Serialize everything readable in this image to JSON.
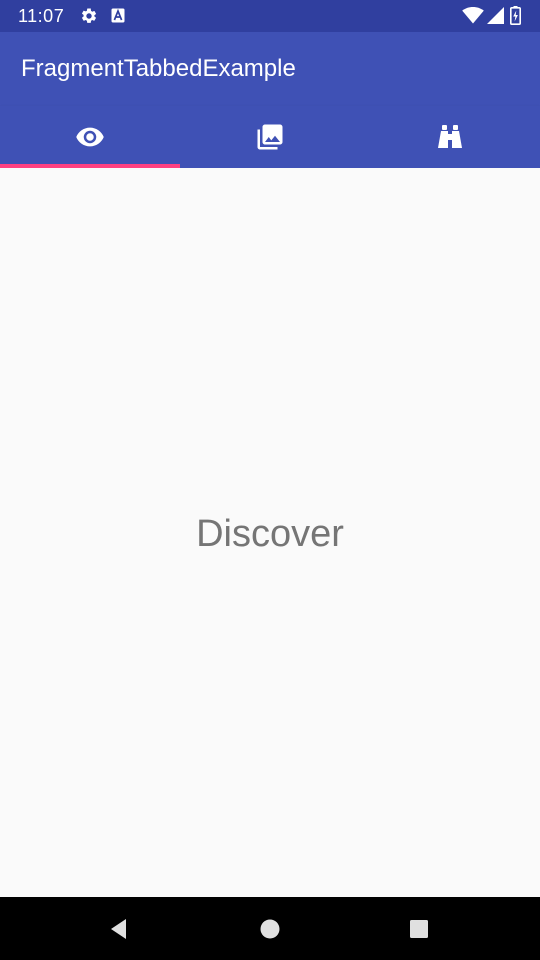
{
  "status_bar": {
    "time": "11:07",
    "icons": [
      "gear-icon",
      "a-notification-icon",
      "wifi-icon",
      "cell-signal-icon",
      "battery-icon"
    ]
  },
  "app_bar": {
    "title": "FragmentTabbedExample"
  },
  "tabs": {
    "selected_index": 0,
    "items": [
      {
        "icon": "eye-icon"
      },
      {
        "icon": "photo-library-icon"
      },
      {
        "icon": "binoculars-icon"
      }
    ]
  },
  "content": {
    "text": "Discover"
  },
  "nav_bar": {
    "buttons": [
      "back-icon",
      "home-icon",
      "recents-icon"
    ]
  },
  "colors": {
    "primary": "#3f51b5",
    "primary_dark": "#303f9f",
    "accent": "#ff4081",
    "background": "#fafafa",
    "content_text": "#757575"
  }
}
